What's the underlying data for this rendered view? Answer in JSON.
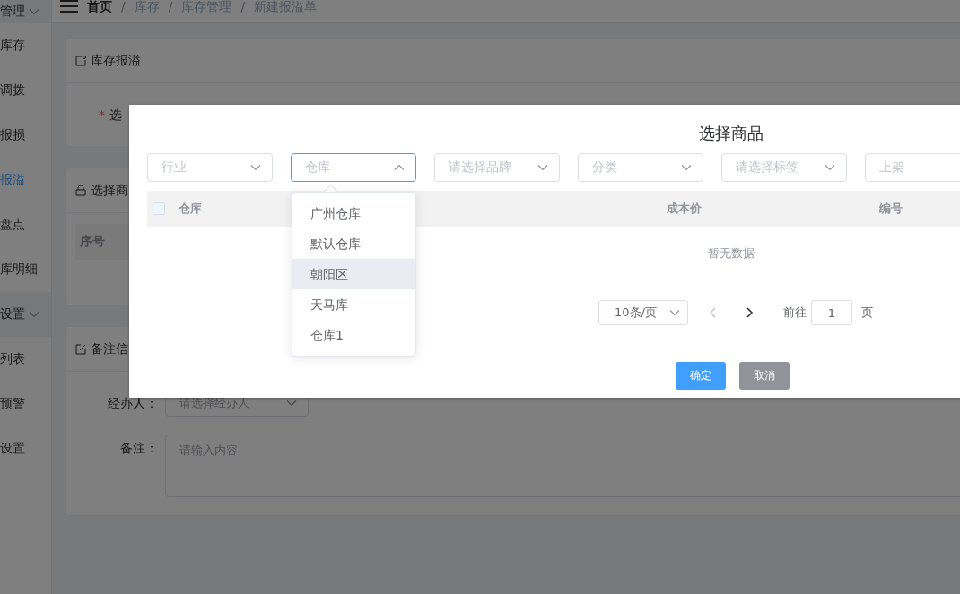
{
  "sidebar": {
    "items": [
      {
        "label": "管理",
        "kind": "group",
        "selected": false
      },
      {
        "label": "库存",
        "kind": "item",
        "selected": false
      },
      {
        "label": "调拨",
        "kind": "item",
        "selected": false
      },
      {
        "label": "报损",
        "kind": "item",
        "selected": false
      },
      {
        "label": "报溢",
        "kind": "item",
        "selected": true
      },
      {
        "label": "盘点",
        "kind": "item",
        "selected": false
      },
      {
        "label": "库明细",
        "kind": "item",
        "selected": false
      },
      {
        "label": "设置",
        "kind": "group",
        "selected": false
      },
      {
        "label": "列表",
        "kind": "item",
        "selected": false
      },
      {
        "label": "预警",
        "kind": "item",
        "selected": false
      },
      {
        "label": "设置",
        "kind": "item",
        "selected": false
      }
    ]
  },
  "header": {
    "separator": "/",
    "breadcrumb": [
      "首页",
      "库存",
      "库存管理",
      "新建报溢单"
    ]
  },
  "stock_card": {
    "title": "库存报溢",
    "field_label": "选",
    "required_mark": "*"
  },
  "goods_card": {
    "title": "选择商",
    "columns": [
      "序号"
    ]
  },
  "notes_card": {
    "title": "备注信",
    "fields": [
      {
        "label": "经办人：",
        "placeholder": "请选择经办人",
        "kind": "select"
      },
      {
        "label": "备注：",
        "placeholder": "请输入内容",
        "kind": "textarea"
      }
    ]
  },
  "dialog": {
    "title": "选择商品",
    "filters": [
      {
        "placeholder": "行业",
        "open": false
      },
      {
        "placeholder": "仓库",
        "open": true
      },
      {
        "placeholder": "请选择品牌",
        "open": false
      },
      {
        "placeholder": "分类",
        "open": false
      },
      {
        "placeholder": "请选择标签",
        "open": false
      },
      {
        "placeholder": "上架",
        "open": false
      }
    ],
    "dropdown": {
      "options": [
        {
          "label": "广州仓库",
          "highlighted": false
        },
        {
          "label": "默认仓库",
          "highlighted": false
        },
        {
          "label": "朝阳区",
          "highlighted": true
        },
        {
          "label": "天马库",
          "highlighted": false
        },
        {
          "label": "仓库1",
          "highlighted": false
        }
      ]
    },
    "table": {
      "select_all_checked": false,
      "columns": [
        "仓库",
        "成本价",
        "编号"
      ],
      "empty_text": "暂无数据"
    },
    "pagination": {
      "page_size": "10条/页",
      "goto_label": "前往",
      "page": "1",
      "page_suffix": "页"
    },
    "buttons": [
      {
        "label": "确定",
        "kind": "primary"
      },
      {
        "label": "取消",
        "kind": "secondary"
      }
    ]
  }
}
